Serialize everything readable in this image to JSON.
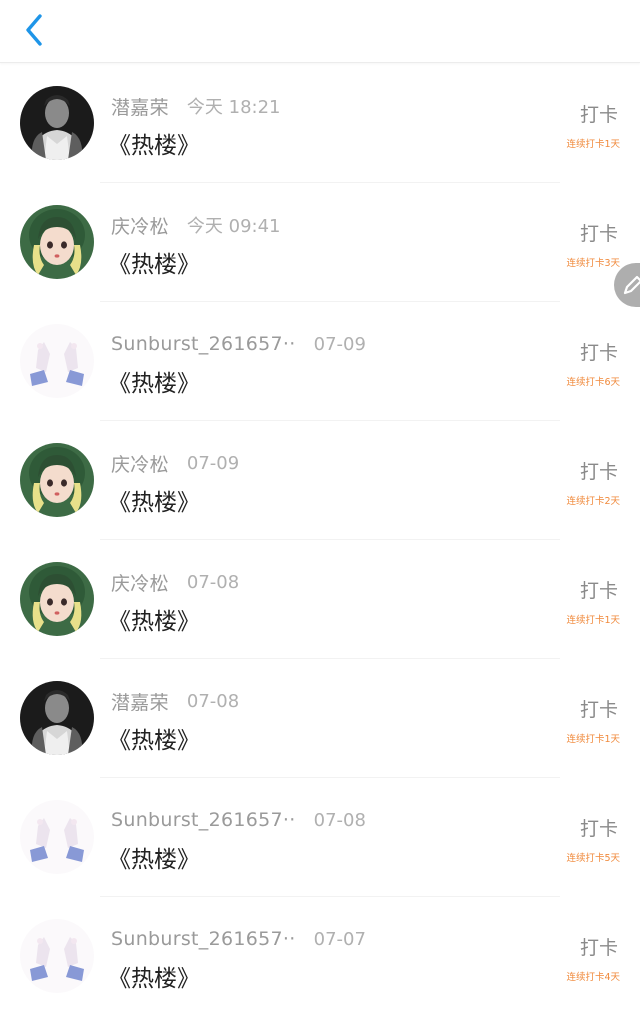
{
  "header": {
    "back_icon": "chevron-left-icon",
    "accent_color": "#1e95e8"
  },
  "action_color": "#f08a3c",
  "entries": [
    {
      "name": "潜嘉荣",
      "time": "今天 18:21",
      "title": "《热楼》",
      "action": "打卡",
      "streak": "连续打卡1天",
      "avatar": "man-portrait"
    },
    {
      "name": "庆冷松",
      "time": "今天 09:41",
      "title": "《热楼》",
      "action": "打卡",
      "streak": "连续打卡3天",
      "avatar": "girl-illustration"
    },
    {
      "name": "Sunburst_261657··",
      "time": "07-09",
      "title": "《热楼》",
      "action": "打卡",
      "streak": "连续打卡6天",
      "avatar": "hands-heart"
    },
    {
      "name": "庆冷松",
      "time": "07-09",
      "title": "《热楼》",
      "action": "打卡",
      "streak": "连续打卡2天",
      "avatar": "girl-illustration"
    },
    {
      "name": "庆冷松",
      "time": "07-08",
      "title": "《热楼》",
      "action": "打卡",
      "streak": "连续打卡1天",
      "avatar": "girl-illustration"
    },
    {
      "name": "潜嘉荣",
      "time": "07-08",
      "title": "《热楼》",
      "action": "打卡",
      "streak": "连续打卡1天",
      "avatar": "man-portrait"
    },
    {
      "name": "Sunburst_261657··",
      "time": "07-08",
      "title": "《热楼》",
      "action": "打卡",
      "streak": "连续打卡5天",
      "avatar": "hands-heart"
    },
    {
      "name": "Sunburst_261657··",
      "time": "07-07",
      "title": "《热楼》",
      "action": "打卡",
      "streak": "连续打卡4天",
      "avatar": "hands-heart"
    }
  ],
  "floating_button": {
    "icon": "pencil-icon"
  }
}
